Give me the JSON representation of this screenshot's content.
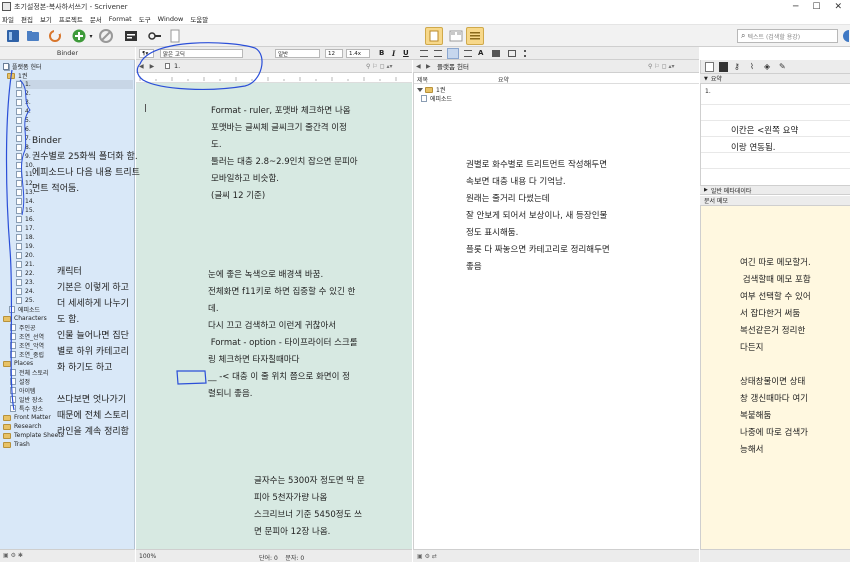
{
  "window": {
    "title": "초기설정본-복사하서쓰기 - Scrivener"
  },
  "menu": [
    "파일",
    "편집",
    "보기",
    "프로젝트",
    "문서",
    "Format",
    "도구",
    "Window",
    "도움말"
  ],
  "search": {
    "placeholder": "텍스트 (검색할 용강)"
  },
  "binder": {
    "header": "Binder",
    "root": "플랫폼 헌터",
    "group": "1권",
    "chapters": [
      "1.",
      "2.",
      "3.",
      "4.",
      "5.",
      "6.",
      "7.",
      "8.",
      "9.",
      "10.",
      "11.",
      "12.",
      "13.",
      "14.",
      "15.",
      "16.",
      "17.",
      "18.",
      "19.",
      "20.",
      "21.",
      "22.",
      "23.",
      "24.",
      "25."
    ],
    "episode": "에피소드",
    "characters": {
      "label": "Characters",
      "items": [
        "주인공",
        "조연_선역",
        "조연_악역",
        "조연_중립"
      ]
    },
    "places": {
      "label": "Places",
      "items": [
        "전체 스토리",
        "설정",
        "아이템",
        "일반 장소",
        "특수 장소"
      ]
    },
    "front_matter": "Front Matter",
    "research": "Research",
    "template_sheets": "Template Sheets",
    "trash": "Trash"
  },
  "format_bar": {
    "font": "맑은 고딕",
    "style": "일반",
    "size": "12",
    "spacing": "1.4x",
    "bold": "B",
    "italic": "I",
    "underline": "U"
  },
  "editor": {
    "doc_title": "1.",
    "zoom": "100%",
    "stats": "단어: 0    문자: 0"
  },
  "outliner": {
    "doc_title": "플랫폼 헌터",
    "col_title": "제목",
    "col_synopsis": "요약",
    "rows": [
      "1권",
      "에피소드"
    ]
  },
  "inspector": {
    "synopsis_label": "요약",
    "synopsis_text": "1.",
    "metadata_label": "일반 메타데이타",
    "notes_label": "문서 메모"
  },
  "annotations": {
    "binder_note": "Binder\n권수별로 25화씩 폴더화 함.\n에피소드나 다음 내용 트리트\n먼트 적어둠.",
    "character_note": "캐릭터\n기본은 이렇게 하고\n더 세세하게 나누기\n도 함.\n인물 늘어나면 집단\n별로 하위 카테고리\n화 하기도 하고\n\n쓰다보면 엇나가기\n때문에 전체 스토리\n라인을 계속 정리함",
    "format_note": "Format - ruler, 포맷바 체크하면 나옴\n포맷바는 글씨체 글씨크기 줄간격 이정\n도.\n툴러는 대충 2.8~2.9인치 잡으면 문피아\n모바일하고 비슷함.\n(글씨 12 기준)",
    "bg_note": "눈에 좋은 녹색으로 배경색 바꿈.\n전체화면 f11키로 하면 집중할 수 있긴 한\n데.\n다시 끄고 검색하고 이런게 귀찮아서\n Format - option - 타이프라이터 스크롤\n링 체크하면 타자칠때마다\n__ -< 대충 이 줄 위치 쯤으로 화면이 정\n렬되니 좋음.",
    "count_note": "글자수는 5300자 정도면 딱 문\n피아 5천자가량 나옴\n스크리브너 기준 5450정도 쓰\n면 문피아 12장 나옴.",
    "outline_note": "권별로 화수별로 트리트먼트 작성해두면\n속보면 대충 내용 다 기억남.\n원래는 줄거리 다썼는데\n잘 안보게 되어서 보상이나, 새 등장인물\n정도 표시해둠.\n플롯 다 짜놓으면 카테고리로 정리해두면\n좋음",
    "synopsis_note": "이칸은 <왼쪽 요약\n이랑 연동됨.",
    "memo_note": "여긴 따로 메모할거.\n 검색할때 메모 포함\n여부 선택할 수 있어\n서 잡다한거 써둠\n복선같은거 정리한\n다든지\n\n상태창물이면 상태\n창 갱신때마다 여기\n복붙해둠\n나중에 따로 검색가\n능해서"
  },
  "colors": {
    "binder_bg": "#d9e8f8",
    "editor_bg": "#d7e9e2",
    "notes_bg": "#fff8e0",
    "accent": "#3e78c4",
    "ink": "#2b4fd8"
  }
}
